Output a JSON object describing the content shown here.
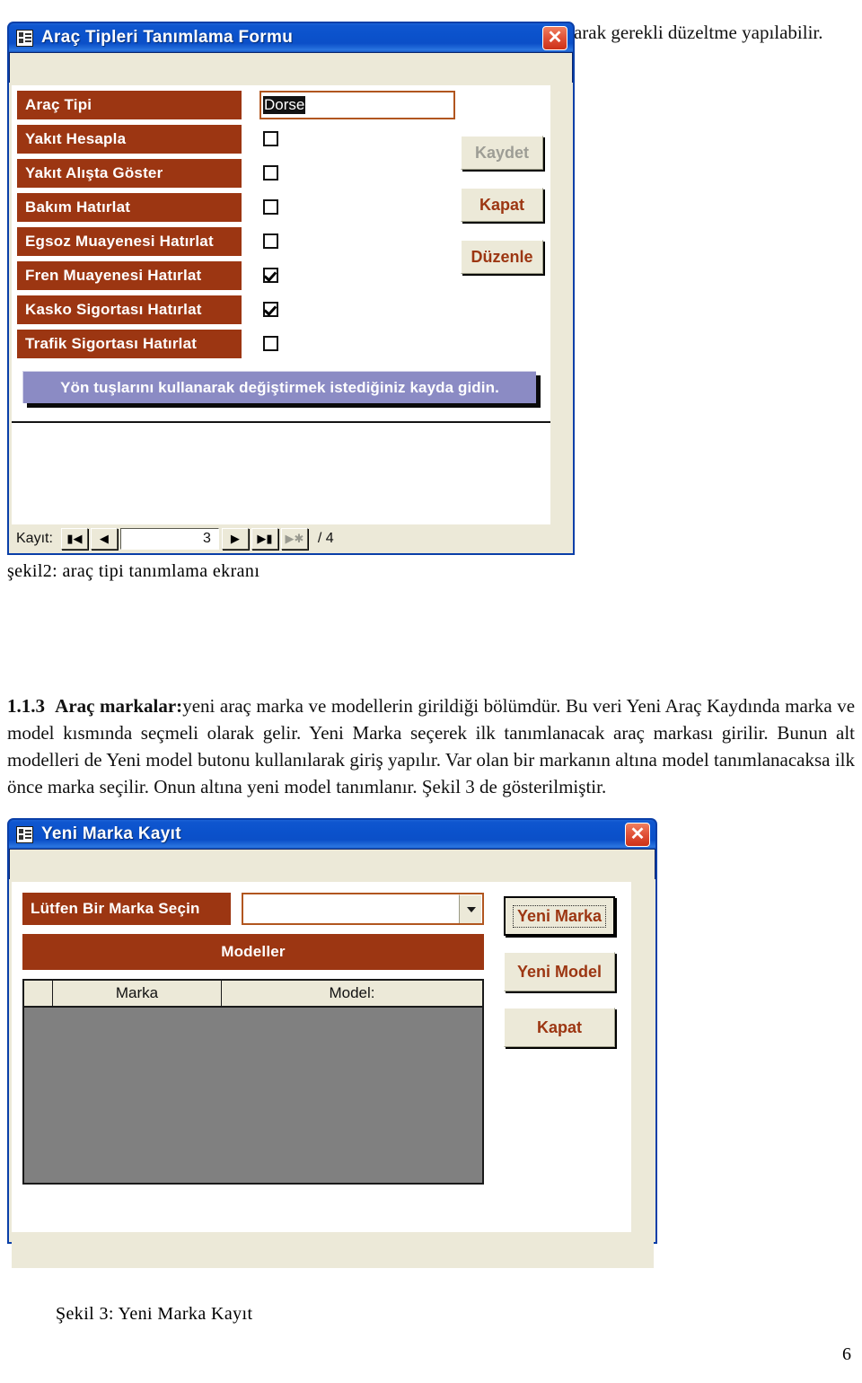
{
  "document": {
    "intro_paragraph": "yapılacağı zamanda gitmek istediğiniz veriye alttaki yön tuşlarından kullanarak gerekli düzeltme yapılabilir.",
    "figure2_caption": "şekil2: araç tipi tanımlama ekranı",
    "section_number": "1.1.3",
    "section_title": "Araç markalar:",
    "section_body": "yeni araç marka ve modellerin girildiği bölümdür. Bu veri Yeni Araç Kaydında marka ve model kısmında seçmeli olarak gelir. Yeni Marka seçerek ilk tanımlanacak araç markası girilir. Bunun alt modelleri de Yeni model butonu kullanılarak giriş yapılır. Var olan bir markanın altına model tanımlanacaksa ilk önce marka seçilir. Onun altına yeni model tanımlanır. Şekil 3 de gösterilmiştir.",
    "figure3_caption": "Şekil 3: Yeni Marka Kayıt",
    "page_number": "6"
  },
  "colors": {
    "titlebar_blue": "#0b52cc",
    "label_maroon": "#9c3612",
    "button_text_maroon": "#9c3612",
    "message_purple": "#8b8bc4",
    "grid_body_gray": "#808080",
    "dialog_face": "#ece9d8",
    "close_red": "#cc3118"
  },
  "dialog1": {
    "title": "Araç Tipleri Tanımlama Formu",
    "window_icon": "form-icon",
    "close_icon": "close-icon",
    "fields": [
      {
        "label": "Araç Tipi",
        "control": "text",
        "value": "Dorse",
        "checked": null
      },
      {
        "label": "Yakıt Hesapla",
        "control": "checkbox",
        "value": "",
        "checked": false
      },
      {
        "label": "Yakıt Alışta Göster",
        "control": "checkbox",
        "value": "",
        "checked": false
      },
      {
        "label": "Bakım Hatırlat",
        "control": "checkbox",
        "value": "",
        "checked": false
      },
      {
        "label": "Egsoz Muayenesi Hatırlat",
        "control": "checkbox",
        "value": "",
        "checked": false
      },
      {
        "label": "Fren Muayenesi Hatırlat",
        "control": "checkbox",
        "value": "",
        "checked": true
      },
      {
        "label": "Kasko Sigortası Hatırlat",
        "control": "checkbox",
        "value": "",
        "checked": true
      },
      {
        "label": "Trafik Sigortası Hatırlat",
        "control": "checkbox",
        "value": "",
        "checked": false
      }
    ],
    "buttons": [
      {
        "label": "Kaydet",
        "disabled": true
      },
      {
        "label": "Kapat",
        "disabled": false
      },
      {
        "label": "Düzenle",
        "disabled": false
      }
    ],
    "message": "Yön tuşlarını kullanarak değiştirmek istediğiniz kayda gidin.",
    "navigator": {
      "label": "Kayıt:",
      "current_record": "3",
      "total_records": "/ 4",
      "first_icon": "first-record-icon",
      "prev_icon": "previous-record-icon",
      "next_icon": "next-record-icon",
      "last_icon": "last-record-icon",
      "new_icon": "new-record-icon"
    }
  },
  "dialog2": {
    "title": "Yeni Marka Kayıt",
    "window_icon": "form-icon",
    "close_icon": "close-icon",
    "select_label": "Lütfen Bir Marka Seçin",
    "select_value": "",
    "dropdown_icon": "chevron-down-icon",
    "section_header": "Modeller",
    "grid_columns": [
      "",
      "Marka",
      "Model:"
    ],
    "grid_rows": [],
    "buttons": [
      {
        "label": "Yeni Marka",
        "focused": true
      },
      {
        "label": "Yeni Model",
        "focused": false
      },
      {
        "label": "Kapat",
        "focused": false
      }
    ]
  }
}
